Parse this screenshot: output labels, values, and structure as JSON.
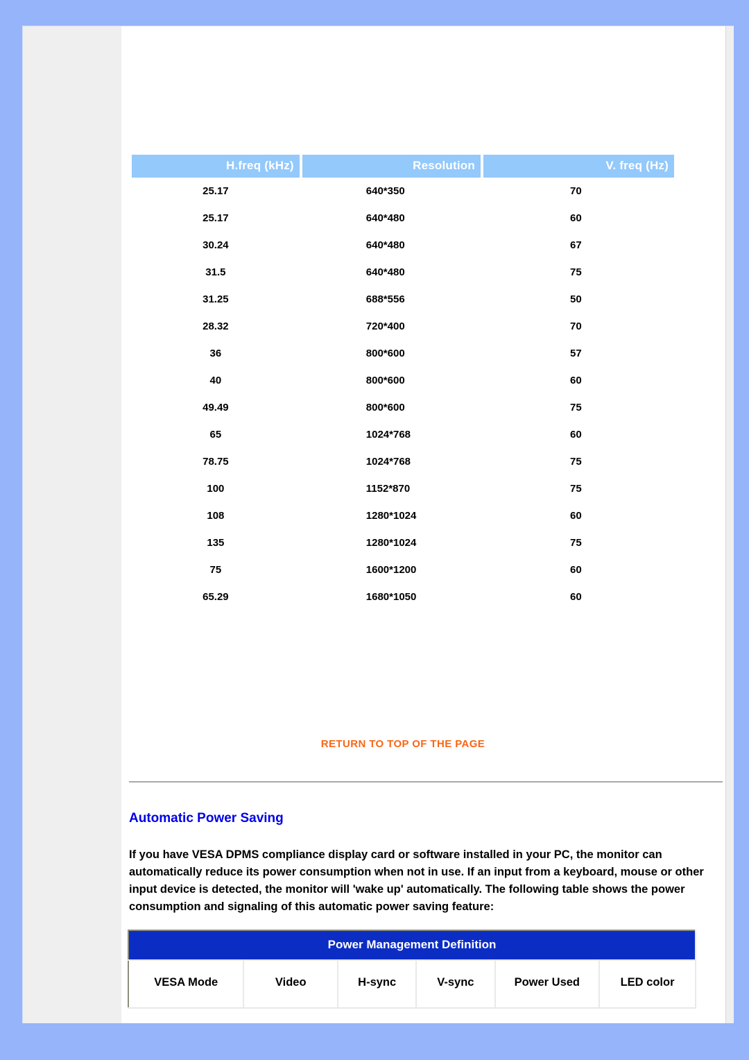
{
  "timing_table": {
    "name": "preset-display-modes-table",
    "headers": [
      "H.freq (kHz)",
      "Resolution",
      "V. freq (Hz)"
    ],
    "rows": [
      [
        "25.17",
        "640*350",
        "70"
      ],
      [
        "25.17",
        "640*480",
        "60"
      ],
      [
        "30.24",
        "640*480",
        "67"
      ],
      [
        "31.5",
        "640*480",
        "75"
      ],
      [
        "31.25",
        "688*556",
        "50"
      ],
      [
        "28.32",
        "720*400",
        "70"
      ],
      [
        "36",
        "800*600",
        "57"
      ],
      [
        "40",
        "800*600",
        "60"
      ],
      [
        "49.49",
        "800*600",
        "75"
      ],
      [
        "65",
        "1024*768",
        "60"
      ],
      [
        "78.75",
        "1024*768",
        "75"
      ],
      [
        "100",
        "1152*870",
        "75"
      ],
      [
        "108",
        "1280*1024",
        "60"
      ],
      [
        "135",
        "1280*1024",
        "75"
      ],
      [
        "75",
        "1600*1200",
        "60"
      ],
      [
        "65.29",
        "1680*1050",
        "60"
      ]
    ]
  },
  "return_link": {
    "label": "RETURN TO TOP OF THE PAGE"
  },
  "power_saving": {
    "heading": "Automatic Power Saving",
    "body": "If you have VESA DPMS compliance display card or software installed in your PC, the monitor can automatically reduce its power consumption when not in use. If an input from a keyboard, mouse or other input device is detected, the monitor will 'wake up' automatically. The following table shows the power consumption and signaling of this automatic power saving feature:"
  },
  "power_management_table": {
    "title": "Power Management Definition",
    "columns": [
      "VESA Mode",
      "Video",
      "H-sync",
      "V-sync",
      "Power Used",
      "LED color"
    ]
  },
  "colors": {
    "page_background": "#96b4fa",
    "paper": "#ffffff",
    "rail": "#efefef",
    "table_header_blue": "#93c9fb",
    "link_orange": "#f96616",
    "heading_blue": "#0000e8",
    "pm_header_blue": "#0c2dc4"
  }
}
